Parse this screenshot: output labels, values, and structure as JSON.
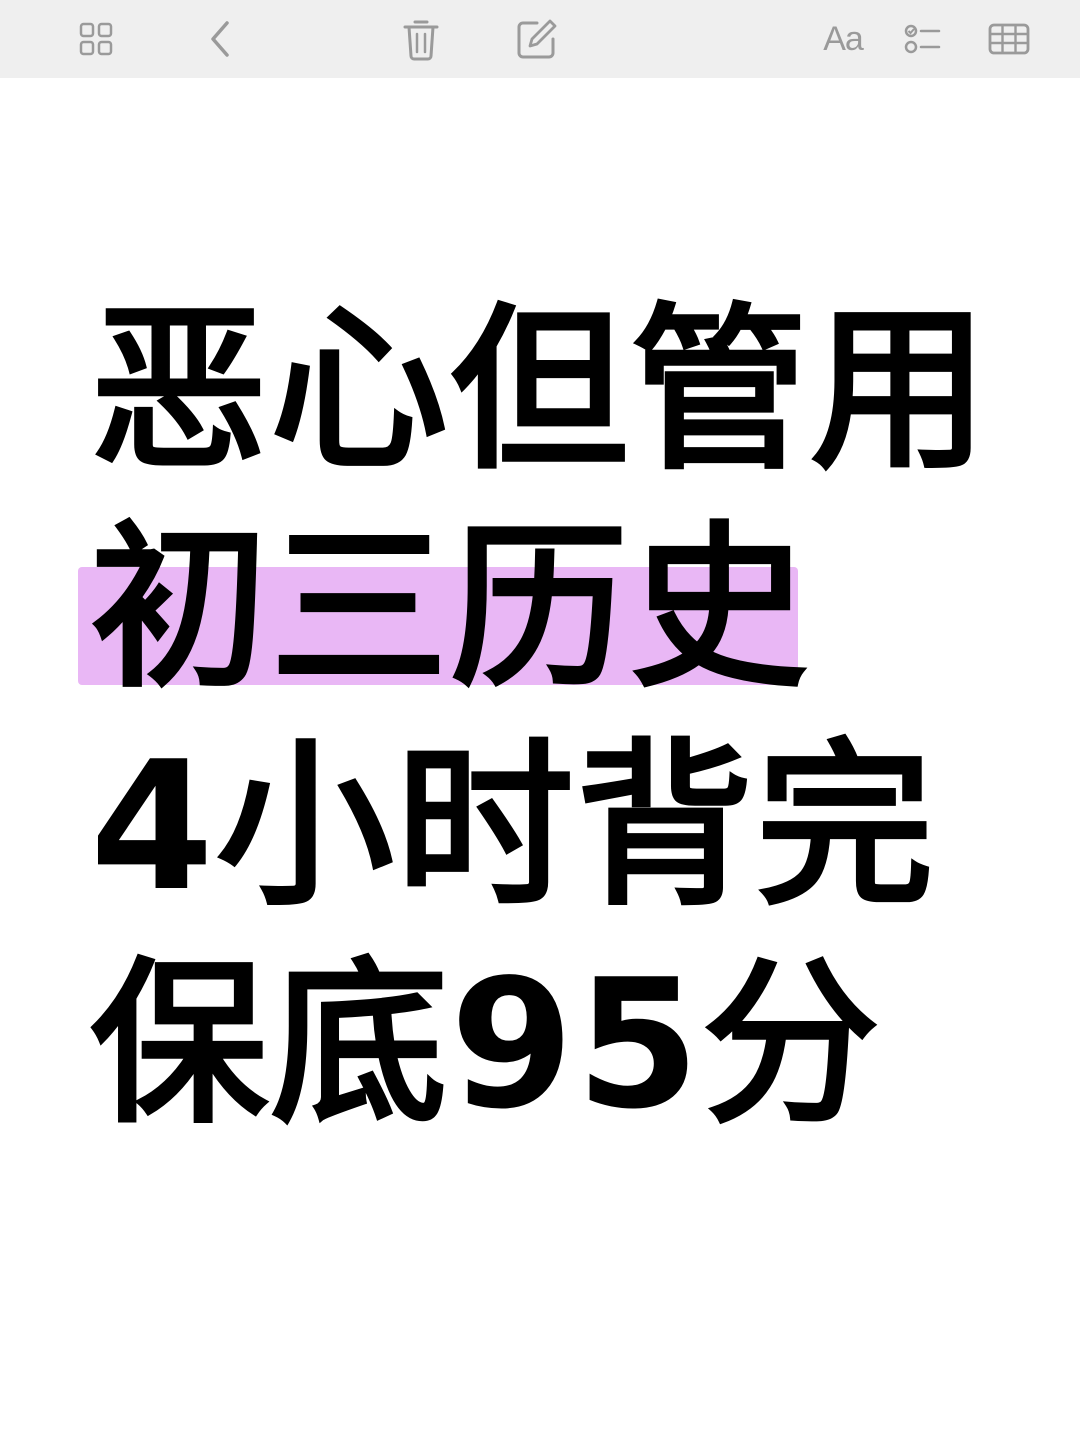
{
  "toolbar": {
    "icons": [
      "grid-icon",
      "back-chevron-icon",
      "trash-icon",
      "compose-icon",
      "text-format-icon",
      "checklist-icon",
      "table-icon"
    ],
    "format_label": "Aa"
  },
  "note": {
    "lines": [
      "恶心但管用",
      "初三历史",
      "4小时背完",
      "保底95分"
    ],
    "highlight_color": "#e9b7f5"
  }
}
